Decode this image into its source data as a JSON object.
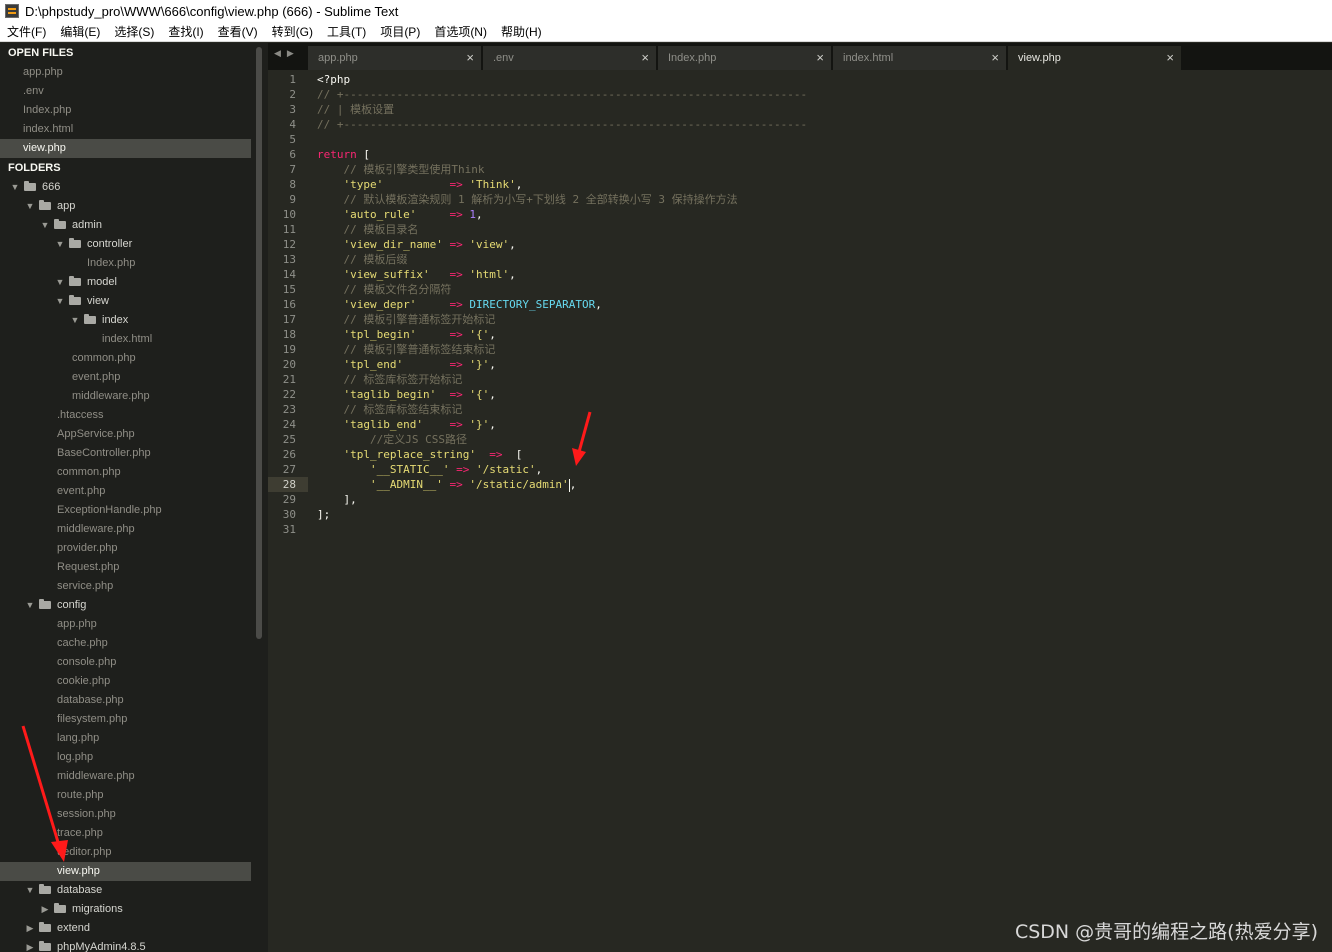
{
  "window": {
    "title": "D:\\phpstudy_pro\\WWW\\666\\config\\view.php (666) - Sublime Text"
  },
  "menu": [
    "文件(F)",
    "编辑(E)",
    "选择(S)",
    "查找(I)",
    "查看(V)",
    "转到(G)",
    "工具(T)",
    "项目(P)",
    "首选项(N)",
    "帮助(H)"
  ],
  "sidebar": {
    "open_files_heading": "OPEN FILES",
    "open_files": [
      "app.php",
      ".env",
      "Index.php",
      "index.html",
      "view.php"
    ],
    "selected_open_file": "view.php",
    "folders_heading": "FOLDERS",
    "tree": [
      {
        "label": "666",
        "type": "folder",
        "depth": 0,
        "expanded": true
      },
      {
        "label": "app",
        "type": "folder",
        "depth": 1,
        "expanded": true
      },
      {
        "label": "admin",
        "type": "folder",
        "depth": 2,
        "expanded": true
      },
      {
        "label": "controller",
        "type": "folder",
        "depth": 3,
        "expanded": true
      },
      {
        "label": "Index.php",
        "type": "file",
        "depth": 4
      },
      {
        "label": "model",
        "type": "folder",
        "depth": 3,
        "expanded": true
      },
      {
        "label": "view",
        "type": "folder",
        "depth": 3,
        "expanded": true
      },
      {
        "label": "index",
        "type": "folder",
        "depth": 4,
        "expanded": true
      },
      {
        "label": "index.html",
        "type": "file",
        "depth": 5
      },
      {
        "label": "common.php",
        "type": "file",
        "depth": 3
      },
      {
        "label": "event.php",
        "type": "file",
        "depth": 3
      },
      {
        "label": "middleware.php",
        "type": "file",
        "depth": 3
      },
      {
        "label": ".htaccess",
        "type": "file",
        "depth": 2
      },
      {
        "label": "AppService.php",
        "type": "file",
        "depth": 2
      },
      {
        "label": "BaseController.php",
        "type": "file",
        "depth": 2
      },
      {
        "label": "common.php",
        "type": "file",
        "depth": 2
      },
      {
        "label": "event.php",
        "type": "file",
        "depth": 2
      },
      {
        "label": "ExceptionHandle.php",
        "type": "file",
        "depth": 2
      },
      {
        "label": "middleware.php",
        "type": "file",
        "depth": 2
      },
      {
        "label": "provider.php",
        "type": "file",
        "depth": 2
      },
      {
        "label": "Request.php",
        "type": "file",
        "depth": 2
      },
      {
        "label": "service.php",
        "type": "file",
        "depth": 2
      },
      {
        "label": "config",
        "type": "folder",
        "depth": 1,
        "expanded": true
      },
      {
        "label": "app.php",
        "type": "file",
        "depth": 2
      },
      {
        "label": "cache.php",
        "type": "file",
        "depth": 2
      },
      {
        "label": "console.php",
        "type": "file",
        "depth": 2
      },
      {
        "label": "cookie.php",
        "type": "file",
        "depth": 2
      },
      {
        "label": "database.php",
        "type": "file",
        "depth": 2
      },
      {
        "label": "filesystem.php",
        "type": "file",
        "depth": 2
      },
      {
        "label": "lang.php",
        "type": "file",
        "depth": 2
      },
      {
        "label": "log.php",
        "type": "file",
        "depth": 2
      },
      {
        "label": "middleware.php",
        "type": "file",
        "depth": 2
      },
      {
        "label": "route.php",
        "type": "file",
        "depth": 2
      },
      {
        "label": "session.php",
        "type": "file",
        "depth": 2
      },
      {
        "label": "trace.php",
        "type": "file",
        "depth": 2
      },
      {
        "label": "ueditor.php",
        "type": "file",
        "depth": 2
      },
      {
        "label": "view.php",
        "type": "file",
        "depth": 2,
        "selected": true
      },
      {
        "label": "database",
        "type": "folder",
        "depth": 1,
        "expanded": true
      },
      {
        "label": "migrations",
        "type": "folder",
        "depth": 2,
        "expanded": false
      },
      {
        "label": "extend",
        "type": "folder",
        "depth": 1,
        "expanded": false
      },
      {
        "label": "phpMyAdmin4.8.5",
        "type": "folder",
        "depth": 1,
        "expanded": false
      }
    ]
  },
  "tabs": [
    {
      "label": "app.php",
      "active": false
    },
    {
      "label": ".env",
      "active": false
    },
    {
      "label": "Index.php",
      "active": false
    },
    {
      "label": "index.html",
      "active": false
    },
    {
      "label": "view.php",
      "active": true
    }
  ],
  "tab_close_glyph": "×",
  "editor": {
    "current_line": 28,
    "lines": [
      [
        [
          "plain",
          "<?php"
        ]
      ],
      [
        [
          "com",
          "// +----------------------------------------------------------------------"
        ]
      ],
      [
        [
          "com",
          "// | 模板设置"
        ]
      ],
      [
        [
          "com",
          "// +----------------------------------------------------------------------"
        ]
      ],
      [],
      [
        [
          "kw",
          "return"
        ],
        [
          "plain",
          " ["
        ]
      ],
      [
        [
          "com",
          "    // 模板引擎类型使用Think"
        ]
      ],
      [
        [
          "plain",
          "    "
        ],
        [
          "str",
          "'type'"
        ],
        [
          "plain",
          "          "
        ],
        [
          "op",
          "=>"
        ],
        [
          "plain",
          " "
        ],
        [
          "str",
          "'Think'"
        ],
        [
          "plain",
          ","
        ]
      ],
      [
        [
          "com",
          "    // 默认模板渲染规则 1 解析为小写+下划线 2 全部转换小写 3 保持操作方法"
        ]
      ],
      [
        [
          "plain",
          "    "
        ],
        [
          "str",
          "'auto_rule'"
        ],
        [
          "plain",
          "     "
        ],
        [
          "op",
          "=>"
        ],
        [
          "plain",
          " "
        ],
        [
          "num",
          "1"
        ],
        [
          "plain",
          ","
        ]
      ],
      [
        [
          "com",
          "    // 模板目录名"
        ]
      ],
      [
        [
          "plain",
          "    "
        ],
        [
          "str",
          "'view_dir_name'"
        ],
        [
          "plain",
          " "
        ],
        [
          "op",
          "=>"
        ],
        [
          "plain",
          " "
        ],
        [
          "str",
          "'view'"
        ],
        [
          "plain",
          ","
        ]
      ],
      [
        [
          "com",
          "    // 模板后缀"
        ]
      ],
      [
        [
          "plain",
          "    "
        ],
        [
          "str",
          "'view_suffix'"
        ],
        [
          "plain",
          "   "
        ],
        [
          "op",
          "=>"
        ],
        [
          "plain",
          " "
        ],
        [
          "str",
          "'html'"
        ],
        [
          "plain",
          ","
        ]
      ],
      [
        [
          "com",
          "    // 模板文件名分隔符"
        ]
      ],
      [
        [
          "plain",
          "    "
        ],
        [
          "str",
          "'view_depr'"
        ],
        [
          "plain",
          "     "
        ],
        [
          "op",
          "=>"
        ],
        [
          "plain",
          " "
        ],
        [
          "const",
          "DIRECTORY_SEPARATOR"
        ],
        [
          "plain",
          ","
        ]
      ],
      [
        [
          "com",
          "    // 模板引擎普通标签开始标记"
        ]
      ],
      [
        [
          "plain",
          "    "
        ],
        [
          "str",
          "'tpl_begin'"
        ],
        [
          "plain",
          "     "
        ],
        [
          "op",
          "=>"
        ],
        [
          "plain",
          " "
        ],
        [
          "str",
          "'{'"
        ],
        [
          "plain",
          ","
        ]
      ],
      [
        [
          "com",
          "    // 模板引擎普通标签结束标记"
        ]
      ],
      [
        [
          "plain",
          "    "
        ],
        [
          "str",
          "'tpl_end'"
        ],
        [
          "plain",
          "       "
        ],
        [
          "op",
          "=>"
        ],
        [
          "plain",
          " "
        ],
        [
          "str",
          "'}'"
        ],
        [
          "plain",
          ","
        ]
      ],
      [
        [
          "com",
          "    // 标签库标签开始标记"
        ]
      ],
      [
        [
          "plain",
          "    "
        ],
        [
          "str",
          "'taglib_begin'"
        ],
        [
          "plain",
          "  "
        ],
        [
          "op",
          "=>"
        ],
        [
          "plain",
          " "
        ],
        [
          "str",
          "'{'"
        ],
        [
          "plain",
          ","
        ]
      ],
      [
        [
          "com",
          "    // 标签库标签结束标记"
        ]
      ],
      [
        [
          "plain",
          "    "
        ],
        [
          "str",
          "'taglib_end'"
        ],
        [
          "plain",
          "    "
        ],
        [
          "op",
          "=>"
        ],
        [
          "plain",
          " "
        ],
        [
          "str",
          "'}'"
        ],
        [
          "plain",
          ","
        ]
      ],
      [
        [
          "com",
          "        //定义JS CSS路径"
        ]
      ],
      [
        [
          "plain",
          "    "
        ],
        [
          "str",
          "'tpl_replace_string'"
        ],
        [
          "plain",
          "  "
        ],
        [
          "op",
          "=>"
        ],
        [
          "plain",
          "  ["
        ]
      ],
      [
        [
          "plain",
          "        "
        ],
        [
          "str",
          "'__STATIC__'"
        ],
        [
          "plain",
          " "
        ],
        [
          "op",
          "=>"
        ],
        [
          "plain",
          " "
        ],
        [
          "str",
          "'/static'"
        ],
        [
          "plain",
          ","
        ]
      ],
      [
        [
          "plain",
          "        "
        ],
        [
          "str",
          "'__ADMIN__'"
        ],
        [
          "plain",
          " "
        ],
        [
          "op",
          "=>"
        ],
        [
          "plain",
          " "
        ],
        [
          "str",
          "'/static/admin'"
        ],
        [
          "plain",
          ","
        ]
      ],
      [
        [
          "plain",
          "    ],"
        ]
      ],
      [
        [
          "plain",
          "];"
        ]
      ],
      []
    ]
  },
  "watermark": "CSDN @贵哥的编程之路(热爱分享)",
  "colors": {
    "background": "#272822",
    "sidebar": "#1e1f1c",
    "comment": "#75715e",
    "string": "#e6db74",
    "keyword": "#f92672",
    "number": "#ae81ff",
    "constant": "#66d9ef",
    "annotation_arrow": "#ff1a1a"
  }
}
